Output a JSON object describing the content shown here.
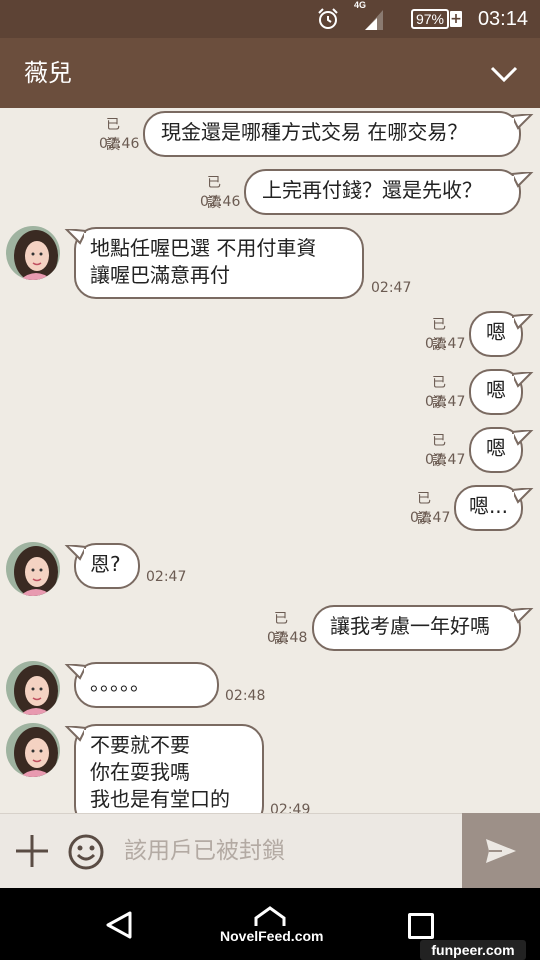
{
  "status_bar": {
    "network": "4G",
    "battery": "97%",
    "time": "03:14",
    "icons": [
      "alarm-icon",
      "signal-icon",
      "battery-icon"
    ]
  },
  "header": {
    "contact_name": "薇兒",
    "icon": "chevron-down-icon"
  },
  "messages": [
    {
      "direction": "out",
      "lines": [
        "現金還是哪種方式交易  在哪交易？"
      ],
      "read": "已讀",
      "time": "02:46"
    },
    {
      "direction": "out",
      "lines": [
        "上完再付錢？還是先收？"
      ],
      "read": "已讀",
      "time": "02:46"
    },
    {
      "direction": "in",
      "lines": [
        "地點任喔巴選  不用付車資",
        "讓喔巴滿意再付"
      ],
      "time": "02:47"
    },
    {
      "direction": "out",
      "lines": [
        "嗯"
      ],
      "read": "已讀",
      "time": "02:47"
    },
    {
      "direction": "out",
      "lines": [
        "嗯"
      ],
      "read": "已讀",
      "time": "02:47"
    },
    {
      "direction": "out",
      "lines": [
        "嗯"
      ],
      "read": "已讀",
      "time": "02:47"
    },
    {
      "direction": "out",
      "lines": [
        "嗯..."
      ],
      "read": "已讀",
      "time": "02:47"
    },
    {
      "direction": "in",
      "lines": [
        "恩?"
      ],
      "time": "02:47"
    },
    {
      "direction": "out",
      "lines": [
        "讓我考慮一年好嗎"
      ],
      "read": "已讀",
      "time": "02:48"
    },
    {
      "direction": "in",
      "lines": [
        "。。。。。"
      ],
      "time": "02:48"
    },
    {
      "direction": "in",
      "lines": [
        "不要就不要",
        "你在耍我嗎",
        "我也是有堂口的"
      ],
      "time": "02:49"
    }
  ],
  "input_bar": {
    "placeholder": "該用戶已被封鎖",
    "icons": [
      "plus-icon",
      "emoji-icon",
      "send-icon"
    ]
  },
  "nav_bar": {
    "icons": [
      "back-icon",
      "home-icon",
      "recent-apps-icon"
    ],
    "watermark_left": "NovelFeed.com",
    "watermark_right": "funpeer.com"
  },
  "colors": {
    "status_bar": "#5d4335",
    "header": "#6b4e3d",
    "chat_background": "#efebe4",
    "bubble": "#ffffff",
    "bubble_border": "#7a6a61",
    "send_button": "#9d9088"
  }
}
